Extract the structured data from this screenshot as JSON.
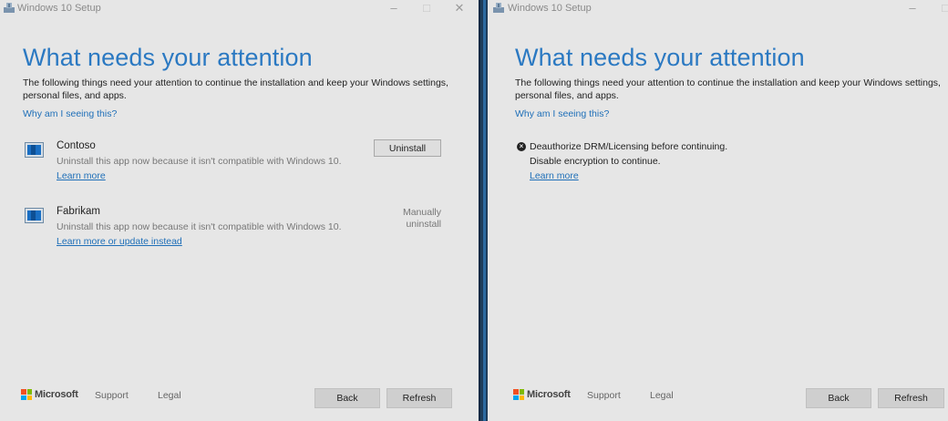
{
  "left": {
    "title": "Windows 10 Setup",
    "heading": "What needs your attention",
    "description": "The following things need your attention to continue the installation and keep your Windows settings, personal files, and apps.",
    "why_link": "Why am I seeing this?",
    "apps": [
      {
        "name": "Contoso",
        "message": "Uninstall this app now because it isn't compatible with Windows 10.",
        "link": "Learn more",
        "action": "Uninstall"
      },
      {
        "name": "Fabrikam",
        "message": "Uninstall this app now because it isn't compatible with Windows 10.",
        "link": "Learn more or update instead",
        "action_lines": [
          "Manually",
          "uninstall"
        ]
      }
    ],
    "footer": {
      "brand": "Microsoft",
      "support": "Support",
      "legal": "Legal",
      "back": "Back",
      "refresh": "Refresh"
    }
  },
  "right": {
    "title": "Windows 10 Setup",
    "heading": "What needs your attention",
    "description": "The following things need your attention to continue the installation and keep your Windows settings, personal files, and apps.",
    "why_link": "Why am I seeing this?",
    "issue": {
      "title": "Deauthorize DRM/Licensing before continuing.",
      "detail": "Disable encryption to continue.",
      "link": "Learn more"
    },
    "footer": {
      "brand": "Microsoft",
      "support": "Support",
      "legal": "Legal",
      "back": "Back",
      "refresh": "Refresh"
    }
  },
  "icons": {
    "title": "windows-setup-icon",
    "minimize": "minimize-icon",
    "maximize": "maximize-icon",
    "close": "close-icon",
    "app": "app-window-icon",
    "error": "error-x-icon",
    "brand": "microsoft-logo-icon"
  },
  "colors": {
    "accent": "#2b79c2",
    "link": "#1f6fb8",
    "ms_red": "#f25022",
    "ms_green": "#7fba00",
    "ms_blue": "#00a4ef",
    "ms_yellow": "#ffb900"
  }
}
